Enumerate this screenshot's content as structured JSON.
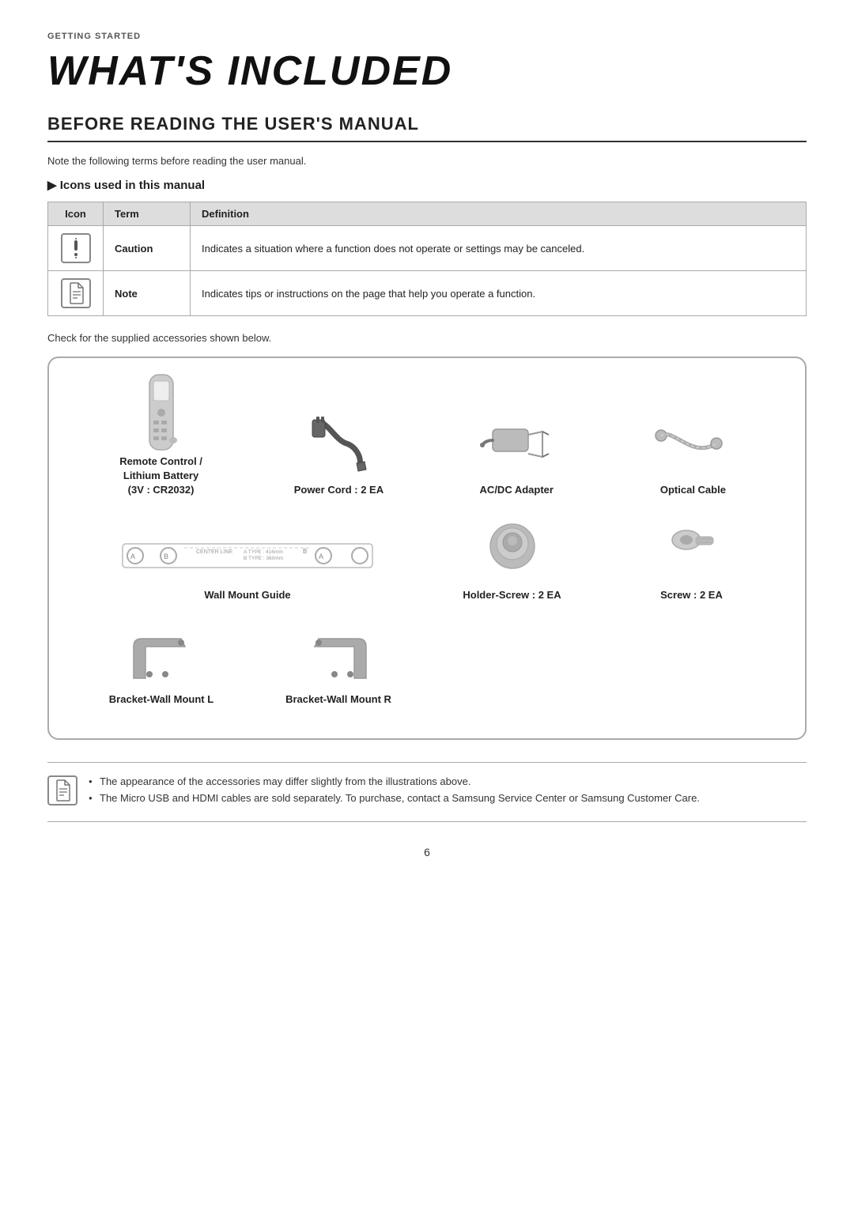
{
  "breadcrumb": "GETTING STARTED",
  "page_title": "WHAT'S INCLUDED",
  "section_title": "BEFORE READING THE USER'S MANUAL",
  "intro_text": "Note the following terms before reading the user manual.",
  "icons_heading": "Icons used in this manual",
  "table": {
    "headers": [
      "Icon",
      "Term",
      "Definition"
    ],
    "rows": [
      {
        "icon": "!",
        "term": "Caution",
        "definition": "Indicates a situation where a function does not operate or settings may be canceled."
      },
      {
        "icon": "✎",
        "term": "Note",
        "definition": "Indicates tips or instructions on the page that help you operate a function."
      }
    ]
  },
  "check_text": "Check for the supplied accessories shown below.",
  "accessories": {
    "row1": [
      {
        "id": "remote-control",
        "label": "Remote Control /\nLithium Battery\n(3V : CR2032)"
      },
      {
        "id": "power-cord",
        "label": "Power Cord : 2 EA"
      },
      {
        "id": "ac-adapter",
        "label": "AC/DC Adapter"
      },
      {
        "id": "optical-cable",
        "label": "Optical Cable"
      }
    ],
    "row2": [
      {
        "id": "wall-mount-guide",
        "label": "Wall Mount Guide",
        "wide": true
      },
      {
        "id": "holder-screw",
        "label": "Holder-Screw : 2 EA"
      },
      {
        "id": "screw",
        "label": "Screw : 2 EA"
      }
    ],
    "row3": [
      {
        "id": "bracket-wall-l",
        "label": "Bracket-Wall Mount L"
      },
      {
        "id": "bracket-wall-r",
        "label": "Bracket-Wall Mount R"
      }
    ]
  },
  "notes": [
    "The appearance of the accessories may differ slightly from the illustrations above.",
    "The Micro USB and HDMI cables are sold separately. To purchase, contact a Samsung Service Center or Samsung Customer Care."
  ],
  "page_number": "6"
}
